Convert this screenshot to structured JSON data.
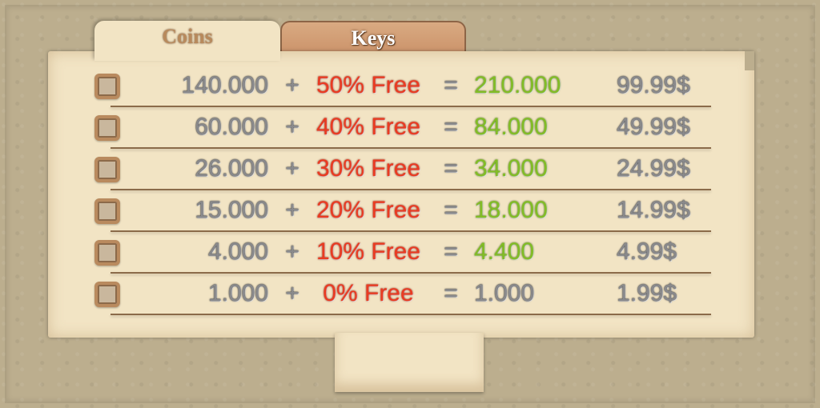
{
  "tabs": [
    {
      "label": "Coins",
      "active": true
    },
    {
      "label": "Keys",
      "active": false
    }
  ],
  "rows": [
    {
      "base": "140.000",
      "plus": "+",
      "bonus": "50% Free",
      "eq": "=",
      "total": "210.000",
      "price": "99.99$",
      "checked": false
    },
    {
      "base": "60.000",
      "plus": "+",
      "bonus": "40% Free",
      "eq": "=",
      "total": "84.000",
      "price": "49.99$",
      "checked": false
    },
    {
      "base": "26.000",
      "plus": "+",
      "bonus": "30% Free",
      "eq": "=",
      "total": "34.000",
      "price": "24.99$",
      "checked": false
    },
    {
      "base": "15.000",
      "plus": "+",
      "bonus": "20% Free",
      "eq": "=",
      "total": "18.000",
      "price": "14.99$",
      "checked": false
    },
    {
      "base": "4.000",
      "plus": "+",
      "bonus": "10% Free",
      "eq": "=",
      "total": "4.400",
      "price": "4.99$",
      "checked": false
    },
    {
      "base": "1.000",
      "plus": "+",
      "bonus": "0% Free",
      "eq": "=",
      "total": "1.000",
      "price": "1.99$",
      "checked": false
    }
  ],
  "colors": {
    "background": "#bcae8e",
    "panel": "#f2e4c4",
    "bonus_text": "#ea3b22",
    "total_text_bonus": "#82bd26",
    "neutral_text": "#8a8a8c",
    "keys_tab": "#d9aa82"
  }
}
